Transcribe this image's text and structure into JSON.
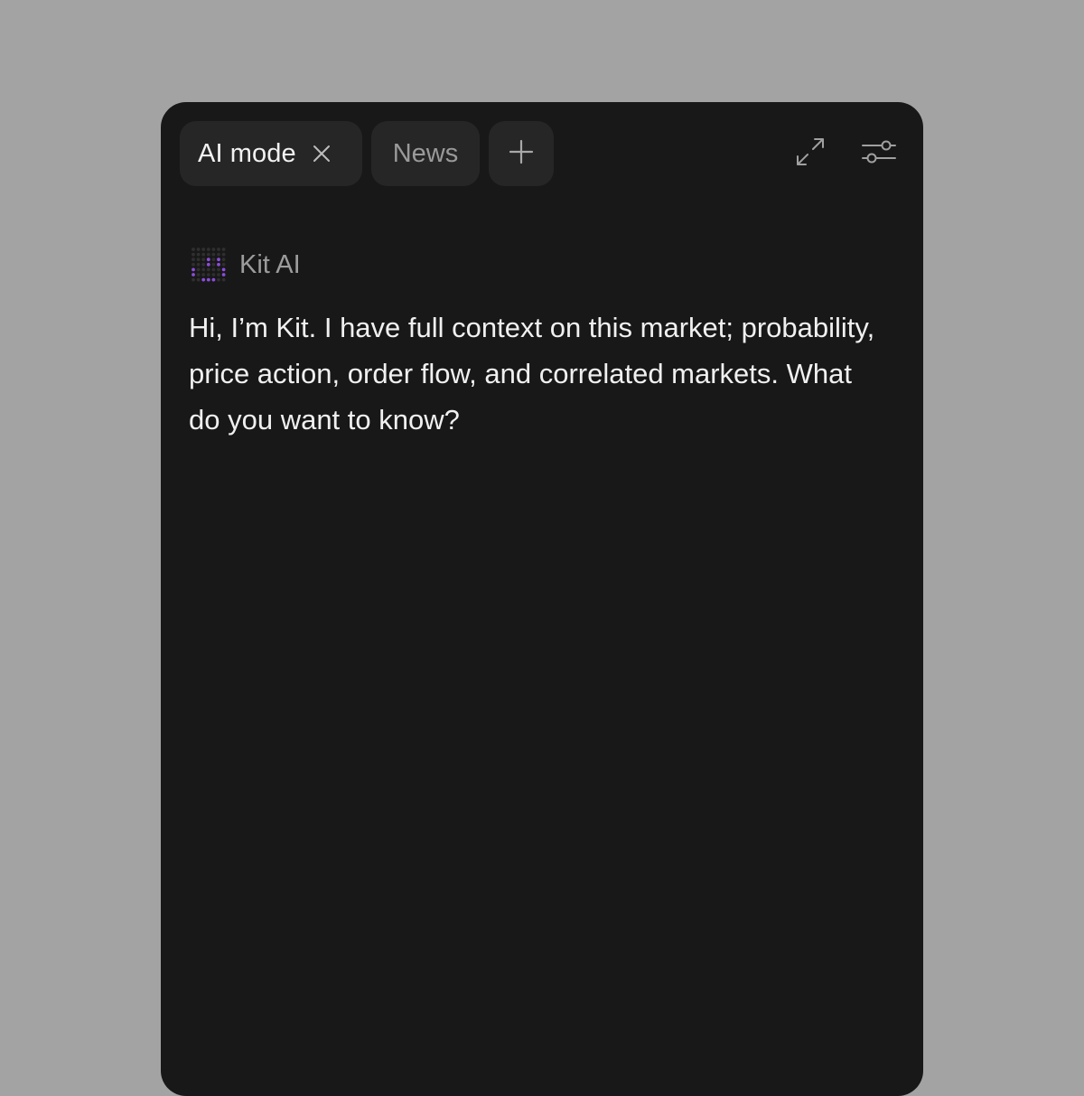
{
  "tabs": [
    {
      "label": "AI mode",
      "active": true,
      "closable": true
    },
    {
      "label": "News",
      "active": false
    }
  ],
  "toolbar": {
    "add_tab_icon": "plus-icon",
    "expand_icon": "expand-arrows-icon",
    "settings_icon": "sliders-icon"
  },
  "assistant": {
    "name": "Kit AI",
    "avatar_icon": "dot-matrix-smile-icon",
    "accent_color": "#8b4ddb",
    "message": "Hi, I’m Kit. I have full context on this market; probability, price action, order flow, and correlated markets. What do you want to know?"
  },
  "colors": {
    "background": "#a3a3a3",
    "panel": "#181818",
    "tab": "#262626",
    "text_primary": "#f0f0f0",
    "text_muted": "#9a9a9a"
  }
}
